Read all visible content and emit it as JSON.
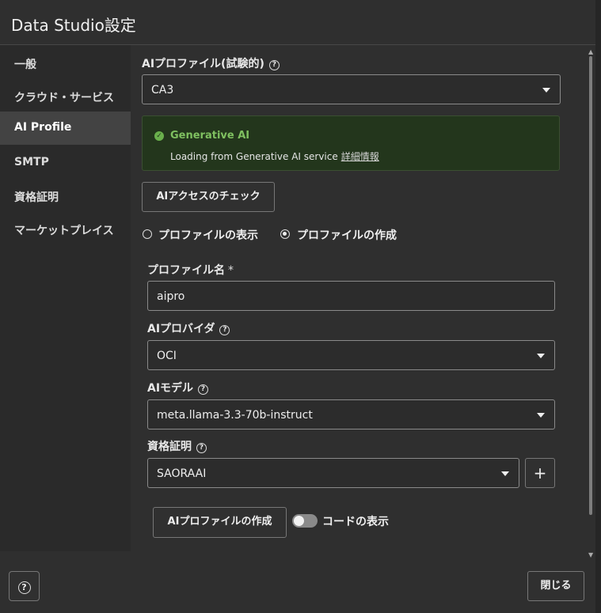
{
  "dialog": {
    "title": "Data Studio設定"
  },
  "sidebar": {
    "items": [
      {
        "label": "一般"
      },
      {
        "label": "クラウド・サービス"
      },
      {
        "label": "AI Profile",
        "active": true
      },
      {
        "label": "SMTP"
      },
      {
        "label": "資格証明"
      },
      {
        "label": "マーケットプレイス"
      }
    ]
  },
  "ai_profile": {
    "label": "AIプロファイル(試験的)",
    "selected": "CA3"
  },
  "alert": {
    "title": "Generative AI",
    "message": "Loading from Generative AI service",
    "link": "詳細情報"
  },
  "check_button": "AIアクセスのチェック",
  "radios": {
    "show": "プロファイルの表示",
    "create": "プロファイルの作成",
    "selected": "create"
  },
  "form": {
    "profile_name_label": "プロファイル名",
    "required_mark": "*",
    "profile_name_value": "aipro",
    "provider_label": "AIプロバイダ",
    "provider_value": "OCI",
    "model_label": "AIモデル",
    "model_value": "meta.llama-3.3-70b-instruct",
    "credential_label": "資格証明",
    "credential_value": "SAORAAI",
    "add_symbol": "+"
  },
  "create_button": "AIプロファイルの作成",
  "code_toggle": {
    "label": "コードの表示",
    "on": false
  },
  "footer": {
    "help": "?",
    "close": "閉じる"
  },
  "help_icon_glyph": "?",
  "colors": {
    "alert_bg": "#23361c",
    "success": "#6ab04c",
    "active_nav": "#434343"
  }
}
